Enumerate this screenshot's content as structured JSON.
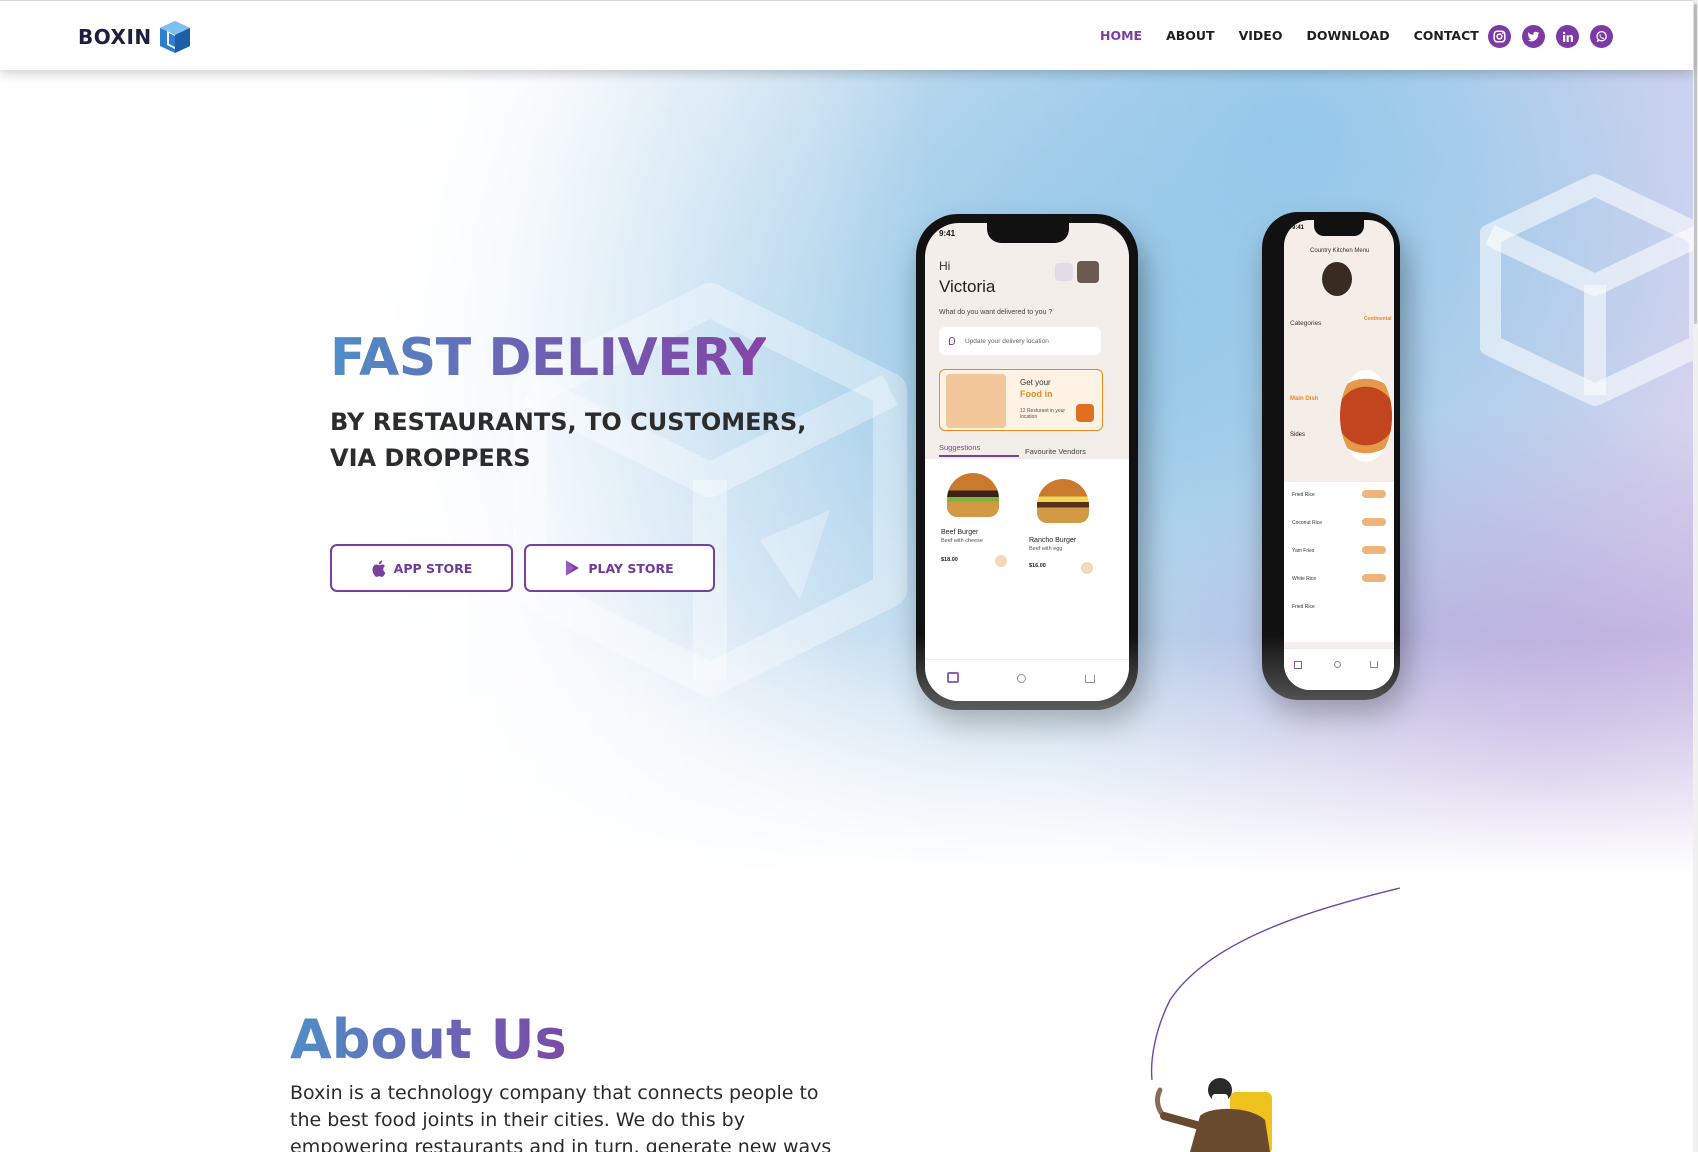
{
  "brand": {
    "name": "BOXIN"
  },
  "nav": {
    "items": [
      {
        "label": "HOME",
        "active": true
      },
      {
        "label": "ABOUT",
        "active": false
      },
      {
        "label": "VIDEO",
        "active": false
      },
      {
        "label": "DOWNLOAD",
        "active": false
      },
      {
        "label": "CONTACT",
        "active": false
      }
    ],
    "socials": [
      "instagram-icon",
      "twitter-icon",
      "linkedin-icon",
      "whatsapp-icon"
    ]
  },
  "hero": {
    "title": "FAST DELIVERY",
    "subtitle": "BY RESTAURANTS, TO CUSTOMERS, VIA DROPPERS",
    "app_store_label": "APP STORE",
    "play_store_label": "PLAY STORE"
  },
  "phone_left": {
    "time": "9:41",
    "greeting": "Hi",
    "name": "Victoria",
    "question": "What do you want delivered to you ?",
    "location_placeholder": "Update your delivery location",
    "promo_line1": "Get your",
    "promo_line2": "Food in",
    "promo_small": "12 Resturant in your location",
    "tab_suggestions": "Suggestions",
    "tab_vendors": "Favourite Vendors",
    "items": [
      {
        "name": "Beef Burger",
        "desc": "Beef with cheese",
        "price": "$18.00"
      },
      {
        "name": "Rancho Burger",
        "desc": "Beef with egg",
        "price": "$16.00"
      }
    ]
  },
  "phone_right": {
    "time": "9:41",
    "title": "Country Kitchen Menu",
    "categories": "Categories",
    "category_tag": "Continental",
    "main_dish": "Main Dish",
    "sides": "Sides",
    "menu": [
      "Fried Rice",
      "Coconut Rice",
      "Yam Fries",
      "White Rice",
      "Fried Rice"
    ]
  },
  "about": {
    "title": "About Us",
    "text": "Boxin is a technology company that connects people to the best food joints in their cities. We do this by empowering restaurants and in turn, generate new ways for people to earn, work and"
  },
  "colors": {
    "accent": "#7b3fa0",
    "blue": "#4f8ec7",
    "orange": "#e88a1e"
  }
}
